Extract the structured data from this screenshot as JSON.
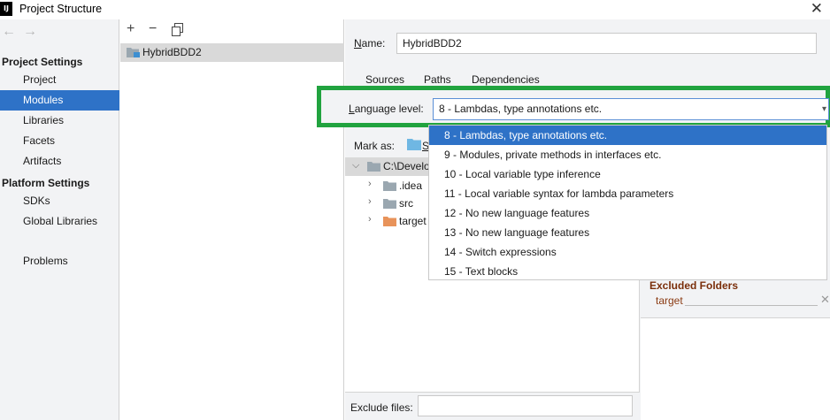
{
  "window": {
    "app_icon": "IJ",
    "title": "Project Structure",
    "close_icon": "close-icon"
  },
  "nav": {
    "back_icon": "back-arrow-icon",
    "forward_icon": "forward-arrow-icon"
  },
  "sidebar": {
    "project_settings_heading": "Project Settings",
    "project_items": [
      "Project",
      "Modules",
      "Libraries",
      "Facets",
      "Artifacts"
    ],
    "platform_settings_heading": "Platform Settings",
    "platform_items": [
      "SDKs",
      "Global Libraries"
    ],
    "problems": "Problems",
    "selected": "Modules",
    "accent_color": "#2e72c7"
  },
  "modules": {
    "toolbar": {
      "add": "+",
      "remove": "−",
      "copy_icon": "copy-icon"
    },
    "items": [
      "HybridBDD2"
    ]
  },
  "details": {
    "name_label": "Name:",
    "name_value": "HybridBDD2",
    "tabs": [
      "Sources",
      "Paths",
      "Dependencies"
    ],
    "language_level_label": "Language level:",
    "language_level_value": "8 - Lambdas, type annotations etc.",
    "mark_as_label": "Mark as:",
    "mark_as_first": "S",
    "tree": {
      "root": "C:\\Develo",
      "children": [
        ".idea",
        "src",
        "target"
      ]
    },
    "excluded": {
      "title": "Excluded Folders",
      "items": [
        "target"
      ]
    },
    "exclude_files_label": "Exclude files:",
    "exclude_files_value": ""
  },
  "language_dropdown": {
    "options": [
      "8 - Lambdas, type annotations etc.",
      "9 - Modules, private methods in interfaces etc.",
      "10 - Local variable type inference",
      "11 - Local variable syntax for lambda parameters",
      "12 - No new language features",
      "13 - No new language features",
      "14 - Switch expressions",
      "15 - Text blocks"
    ],
    "selected": "8 - Lambdas, type annotations etc.",
    "highlight_color": "#21a33f"
  }
}
